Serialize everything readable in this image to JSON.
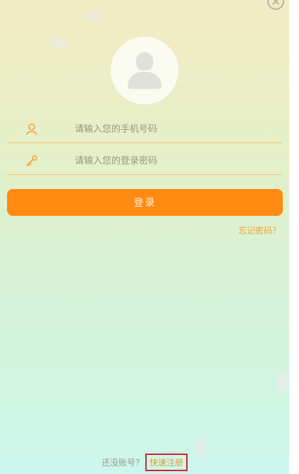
{
  "form": {
    "phone_placeholder": "请输入您的手机号码",
    "password_placeholder": "请输入您的登录密码",
    "login_label": "登录",
    "forgot_label": "忘记密码？"
  },
  "footer": {
    "prompt_text": "还没账号？",
    "register_label": "快速注册"
  },
  "icons": {
    "close": "close-icon",
    "avatar": "user-avatar-icon",
    "phone": "user-icon",
    "password": "key-icon"
  },
  "colors": {
    "accent": "#ff8a12",
    "link": "#f0a43c",
    "highlight_border": "#d4232a"
  }
}
